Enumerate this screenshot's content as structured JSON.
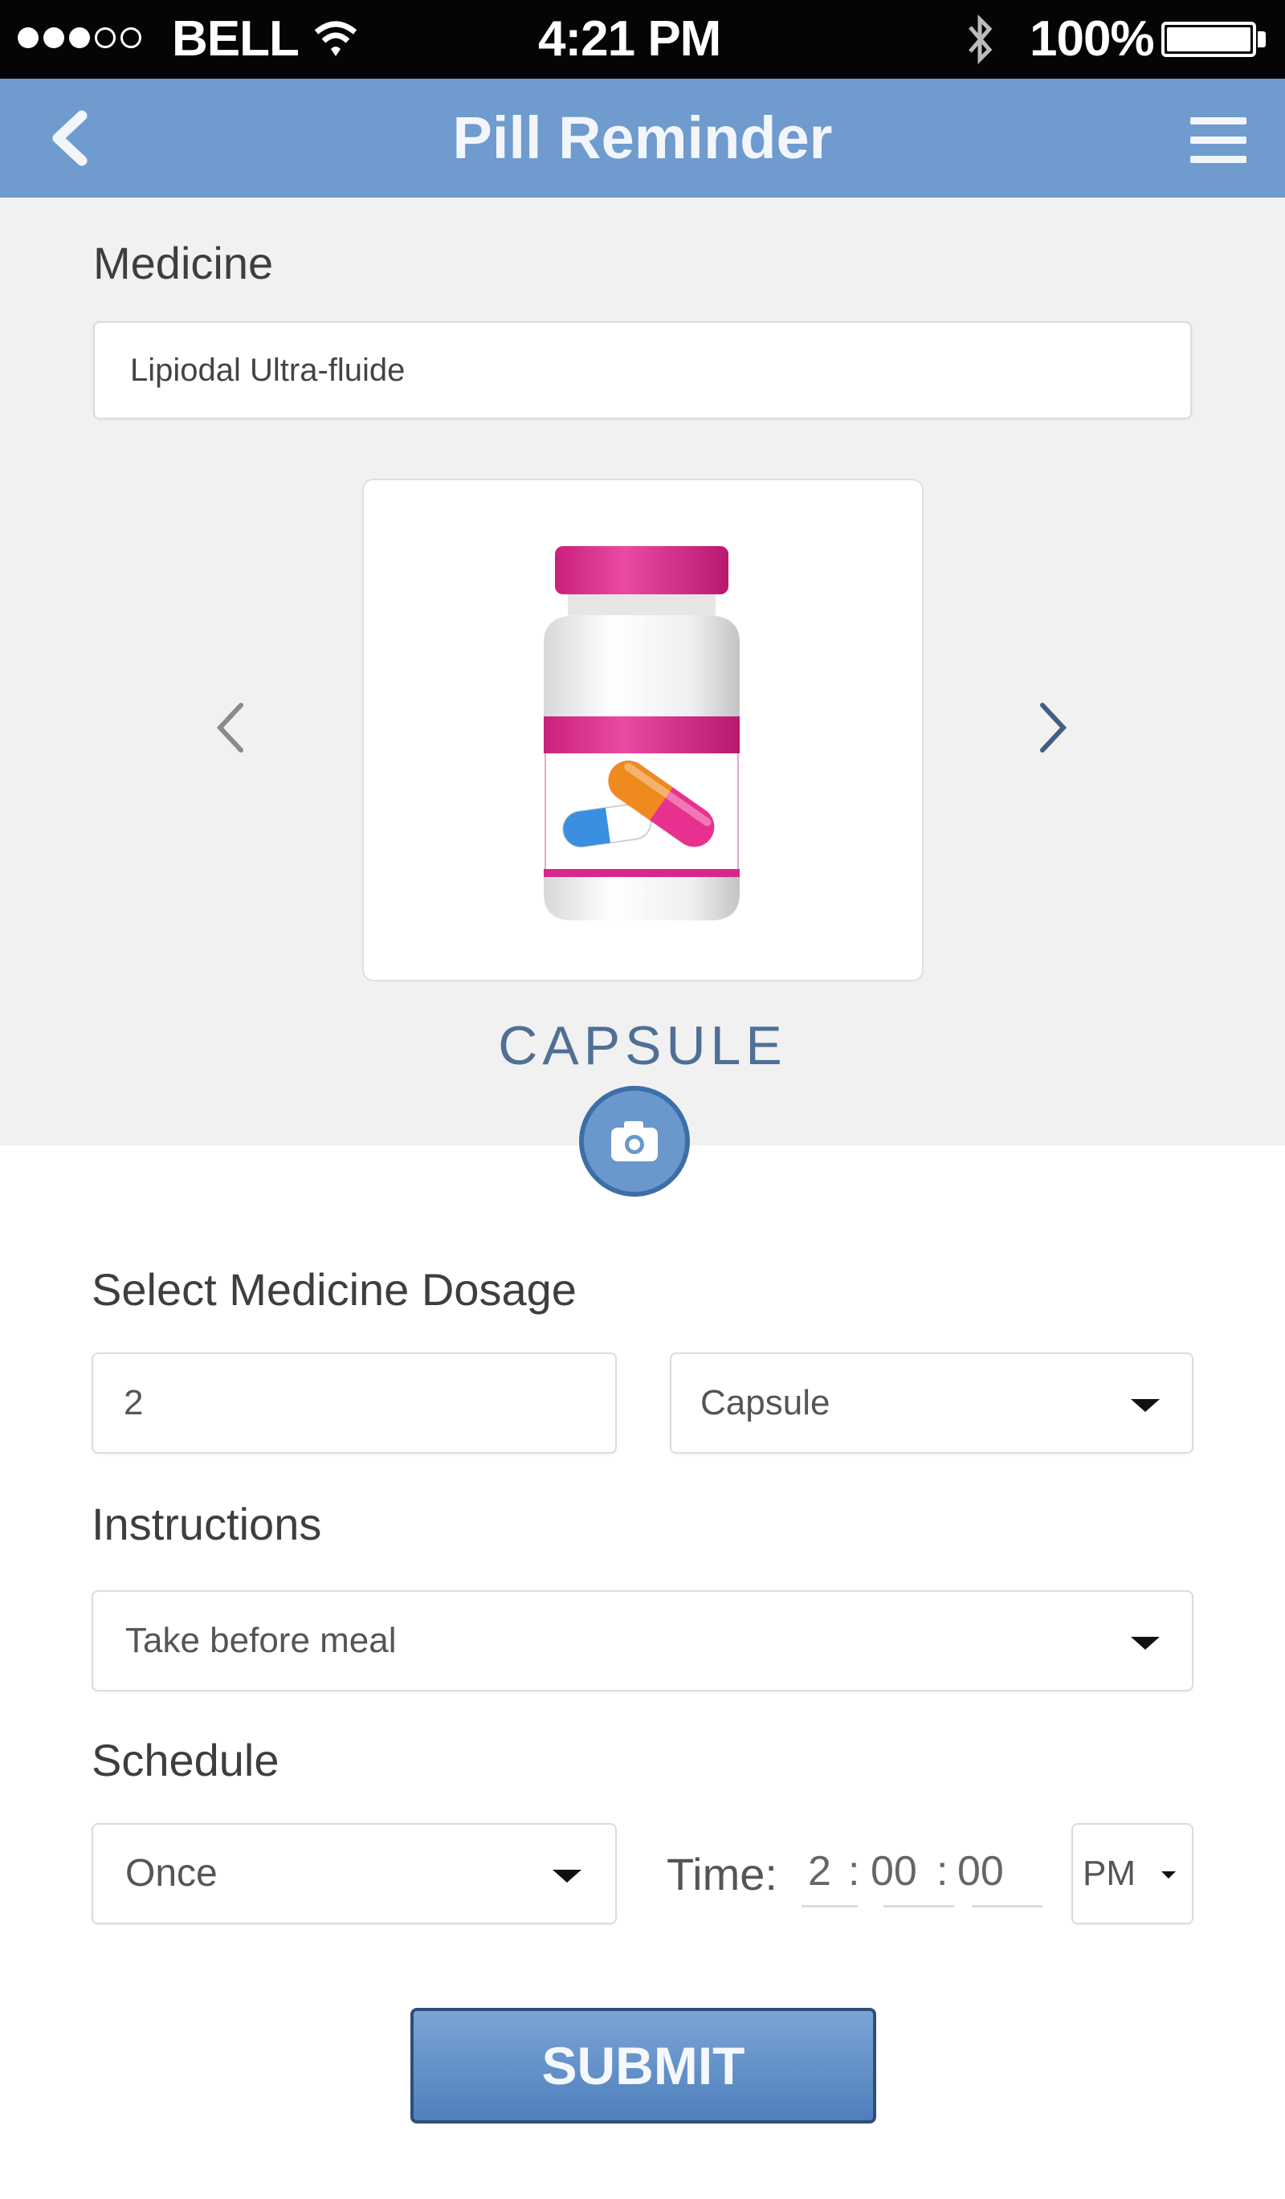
{
  "status_bar": {
    "carrier": "BELL",
    "time": "4:21 PM",
    "battery": "100%"
  },
  "nav": {
    "title": "Pill Reminder",
    "back_icon": "chevron-left-icon",
    "menu_icon": "hamburger-menu-icon"
  },
  "medicine": {
    "label": "Medicine",
    "value": "Lipiodal Ultra-fluide"
  },
  "pill_type": {
    "label": "CAPSULE",
    "image": "capsule-bottle-image"
  },
  "dosage": {
    "label": "Select Medicine Dosage",
    "amount": "2",
    "unit": "Capsule"
  },
  "instructions": {
    "label": "Instructions",
    "value": "Take before meal"
  },
  "schedule": {
    "label": "Schedule",
    "frequency": "Once",
    "time_label": "Time:",
    "hour": "2",
    "minute": "00",
    "second": "00",
    "sep1": ":",
    "sep2": ":",
    "ampm": "PM"
  },
  "submit": {
    "label": "SUBMIT"
  },
  "colors": {
    "nav_bar": "#6f9bce",
    "accent_pink": "#d6288a",
    "submit_button": "#5a88c2"
  }
}
